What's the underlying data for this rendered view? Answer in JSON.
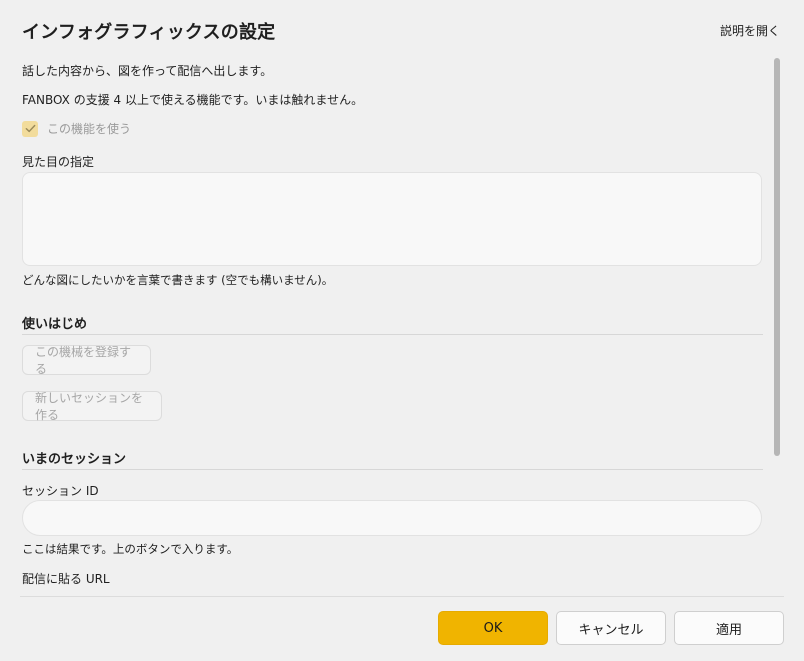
{
  "dialog": {
    "title": "インフォグラフィックスの設定",
    "help_link": "説明を開く"
  },
  "content": {
    "description": "話した内容から、図を作って配信へ出します。",
    "requirement_note": "FANBOX の支援 4 以上で使える機能です。いまは触れません。",
    "enable_checkbox": {
      "label": "この機能を使う",
      "checked": true,
      "disabled": true
    },
    "style_field": {
      "label": "見た目の指定",
      "value": "",
      "help": "どんな図にしたいかを言葉で書きます (空でも構いません)。"
    }
  },
  "getting_started": {
    "title": "使いはじめ",
    "register_button": "この機械を登録する",
    "new_session_button": "新しいセッションを作る"
  },
  "current_session": {
    "title": "いまのセッション",
    "session_id_label": "セッション ID",
    "session_id_value": "",
    "session_help": "ここは結果です。上のボタンで入ります。",
    "url_label": "配信に貼る URL"
  },
  "footer": {
    "ok": "OK",
    "cancel": "キャンセル",
    "apply": "適用"
  },
  "colors": {
    "accent": "#f0b400",
    "checkbox_disabled": "#f2dc9c",
    "background": "#f0f0f0"
  }
}
